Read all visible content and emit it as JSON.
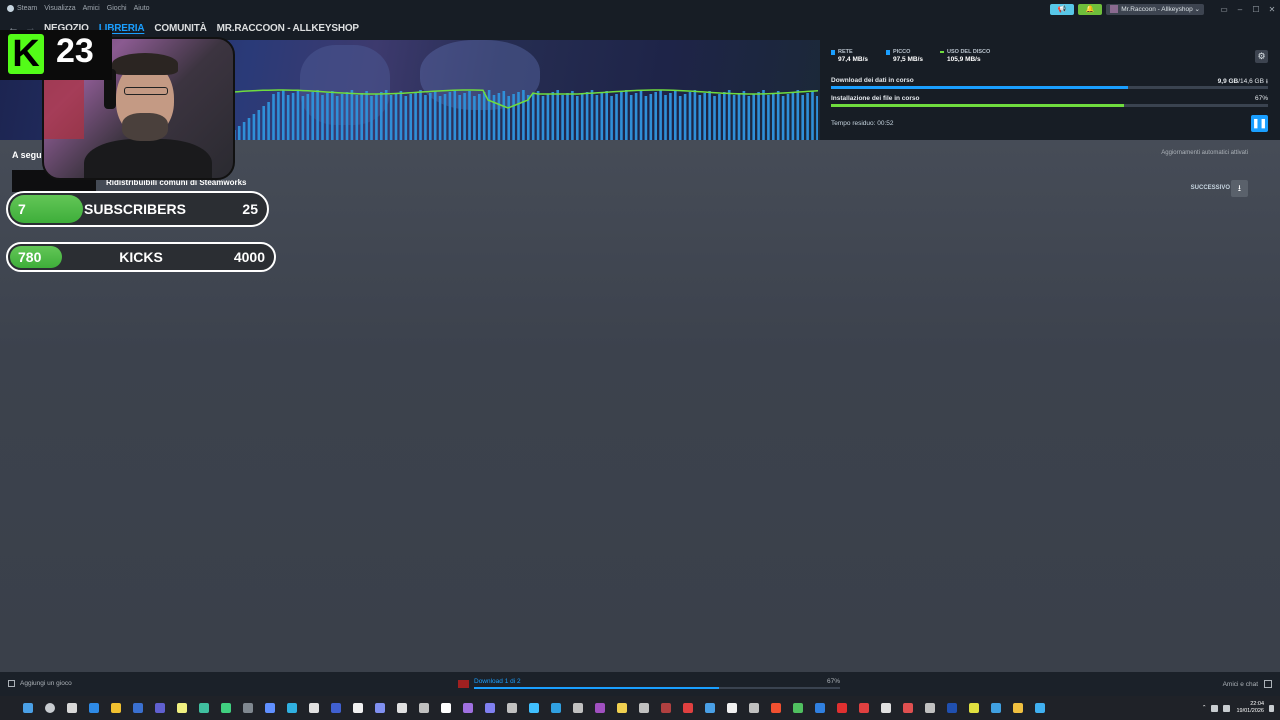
{
  "menubar": {
    "items": [
      "Steam",
      "Visualizza",
      "Amici",
      "Giochi",
      "Aiuto"
    ],
    "account": "Mr.Raccoon - Allkeyshop"
  },
  "nav": {
    "links": [
      {
        "label": "NEGOZIO",
        "active": false
      },
      {
        "label": "LIBRERIA",
        "active": true
      },
      {
        "label": "COMUNITÀ",
        "active": false
      },
      {
        "label": "MR.RACCOON - ALLKEYSHOP",
        "active": false
      }
    ]
  },
  "stats": {
    "network": {
      "label": "RETE",
      "value": "97,4 MB/s",
      "color": "#1a9fff"
    },
    "peak": {
      "label": "PICCO",
      "value": "97,5 MB/s",
      "color": "#1a9fff"
    },
    "disk": {
      "label": "USO DEL DISCO",
      "value": "105,9 MB/s",
      "color": "#6fdc3e"
    }
  },
  "download": {
    "label": "Download dei dati in corso",
    "progress_text_bold": "9,9 GB",
    "progress_text_rest": "/14,6 GB",
    "progress": 0.68,
    "color": "#1a9fff"
  },
  "install": {
    "label": "Installazione dei file in corso",
    "percent": "67%",
    "progress": 0.67,
    "color": "#6fdc3e"
  },
  "time_remaining": "Tempo residuo: 00:52",
  "main": {
    "queue_title": "A segu",
    "auto_updates": "Aggiornamenti automatici attivati",
    "next_label": "SUCCESSIVO",
    "item_name": "Ridistribuibili comuni di Steamworks"
  },
  "overlay": {
    "kick_count": "23",
    "subscribers": {
      "current": "7",
      "label": "SUBSCRIBERS",
      "goal": "25",
      "progress": 0.28
    },
    "kicks": {
      "current": "780",
      "label": "KICKS",
      "goal": "4000",
      "progress": 0.195
    }
  },
  "footer": {
    "add_game": "Aggiungi un gioco",
    "download_text": "Download 1 di 2",
    "download_percent": "67%",
    "download_progress": 0.67,
    "friends_chat": "Amici e chat"
  },
  "taskbar": {
    "time": "22:04",
    "date": "19/01/2026",
    "icon_colors": [
      "#4aa0e6",
      "#c8ccd0",
      "#d8d8d8",
      "#2e8ae6",
      "#f0c030",
      "#3a70d0",
      "#6060d0",
      "#f0f080",
      "#40c0a0",
      "#40d080",
      "#808890",
      "#6090ff",
      "#30b0e0",
      "#e0e0e0",
      "#4060d0",
      "#f0f0f0",
      "#8090f0",
      "#e0e0e0",
      "#c0c0c0",
      "#ffffff",
      "#a070e0",
      "#8080f0",
      "#c0c0c0",
      "#40c0ff",
      "#30a0e0",
      "#c0c0c0",
      "#a050c0",
      "#f0d050",
      "#c0c0c0",
      "#b04040",
      "#e04040",
      "#4aa0e6",
      "#f0f0f0",
      "#c0c0c0",
      "#f05030",
      "#50c060",
      "#3080e0",
      "#e03030",
      "#e04040",
      "#e0e0e0",
      "#e05050",
      "#c0c0c0",
      "#2050b0",
      "#e0e040",
      "#40a0e0",
      "#f0c040",
      "#40b0f0"
    ]
  }
}
